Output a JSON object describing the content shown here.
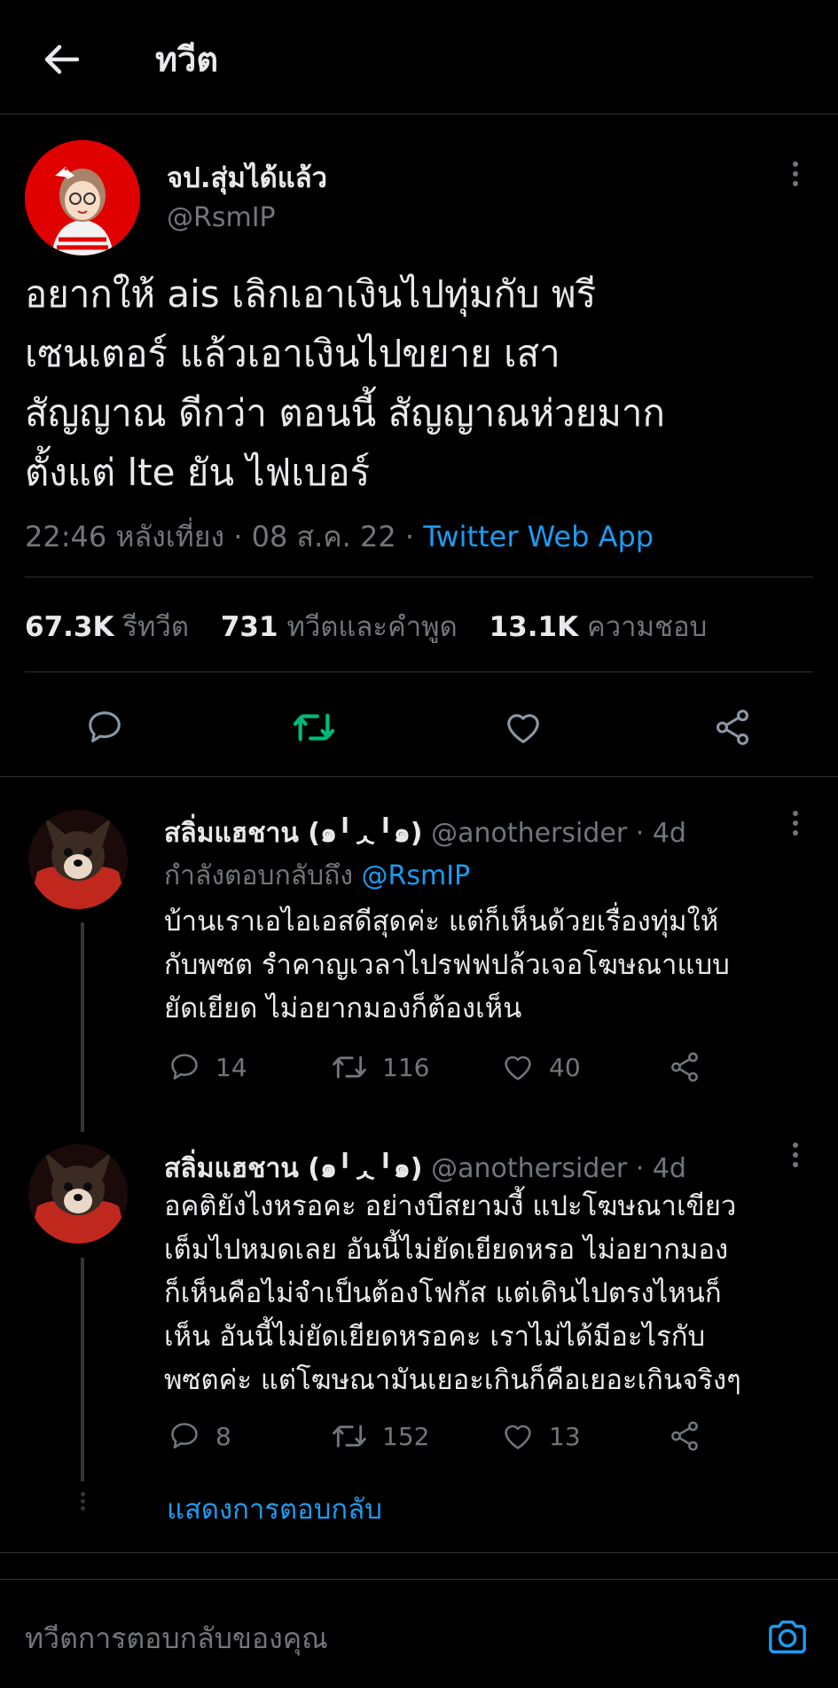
{
  "header": {
    "title": "ทวีต"
  },
  "tweet": {
    "author_name": "จป.สุ่มได้แล้ว",
    "author_handle": "@RsmIP",
    "text": "อยากให้ ais เลิกเอาเงินไปทุ่มกับ พรี\nเซนเตอร์ แล้วเอาเงินไปขยาย เสา\nสัญญาณ ดีกว่า  ตอนนี้ สัญญาณห่วยมาก\nตั้งแต่ lte ยัน ไฟเบอร์",
    "time": "22:46 หลังเที่ยง",
    "sep1": "·",
    "date": "08 ส.ค. 22",
    "sep2": "·",
    "source": "Twitter Web App",
    "retweets_count": "67.3K",
    "retweets_label": "รีทวีต",
    "quotes_count": "731",
    "quotes_label": "ทวีตและคำพูด",
    "likes_count": "13.1K",
    "likes_label": "ความชอบ",
    "retweet_active_color": "#00ba7c"
  },
  "replies": [
    {
      "name": "สลิ่มแฮชาน (๑╹ᆺ╹๑)",
      "handle": "@anothersider",
      "dot": "·",
      "age": "4d",
      "replying_prefix": "กำลังตอบกลับถึง",
      "replying_to": "@RsmIP",
      "text": "บ้านเราเอไอเอสดีสุดค่ะ แต่ก็เห็นด้วยเรื่องทุ่มให้\nกับพซต รำคาญเวลาไปรฟฟปล้วเจอโฆษณาแบบ\nยัดเยียด ไม่อยากมองก็ต้องเห็น",
      "replies": "14",
      "retweets": "116",
      "likes": "40"
    },
    {
      "name": "สลิ่มแฮชาน (๑╹ᆺ╹๑)",
      "handle": "@anothersider",
      "dot": "·",
      "age": "4d",
      "text": "อคติยังไงหรอคะ อย่างบีสยามงี้ แปะโฆษณาเขียว\nเต็มไปหมดเลย อันนี้ไม่ยัดเยียดหรอ ไม่อยากมอง\nก็เห็นคือไม่จำเป็นต้องโฟกัส แต่เดินไปตรงไหนก็\nเห็น อันนี้ไม่ยัดเยียดหรอคะ เราไม่ได้มีอะไรกับ\nพซตค่ะ แต่โฆษณามันเยอะเกินก็คือเยอะเกินจริงๆ",
      "replies": "8",
      "retweets": "152",
      "likes": "13"
    }
  ],
  "show_replies": "แสดงการตอบกลับ",
  "compose": {
    "placeholder": "ทวีตการตอบกลับของคุณ"
  }
}
